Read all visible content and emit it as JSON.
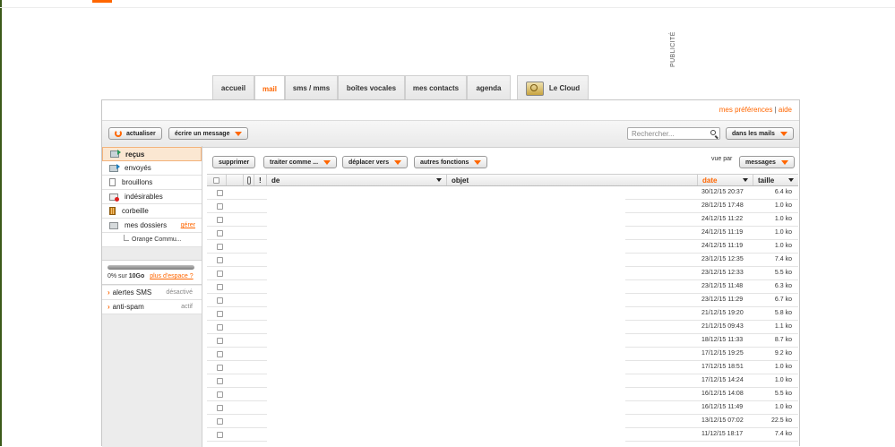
{
  "ad_label": "PUBLICITÉ",
  "tabs": [
    {
      "label": "accueil"
    },
    {
      "label": "mail"
    },
    {
      "label": "sms / mms"
    },
    {
      "label": "boîtes vocales"
    },
    {
      "label": "mes contacts"
    },
    {
      "label": "agenda"
    },
    {
      "label": "Le Cloud"
    }
  ],
  "active_tab": "mail",
  "top_links": {
    "preferences": "mes préférences",
    "separator": "|",
    "help": "aide"
  },
  "toolbar": {
    "refresh": "actualiser",
    "compose": "écrire un message",
    "search_placeholder": "Rechercher...",
    "search_scope": "dans les mails"
  },
  "folders": [
    {
      "label": "reçus"
    },
    {
      "label": "envoyés"
    },
    {
      "label": "brouillons"
    },
    {
      "label": "indésirables"
    },
    {
      "label": "corbeille"
    },
    {
      "label": "mes dossiers",
      "action": "gérer"
    }
  ],
  "subfolder": "Orange Commu...",
  "quota": {
    "used_text": "0% sur ",
    "total": "10Go",
    "more_link": "plus d'espace ?",
    "used_fraction": 0.0
  },
  "options": [
    {
      "label": "alertes SMS",
      "status": "désactivé"
    },
    {
      "label": "anti-spam",
      "status": "actif"
    }
  ],
  "list_toolbar": {
    "delete": "supprimer",
    "treat_as": "traiter comme ...",
    "move_to": "déplacer vers",
    "other": "autres fonctions",
    "view_by_label": "vue par",
    "view_by_value": "messages"
  },
  "columns": {
    "from": "de",
    "subject": "objet",
    "date": "date",
    "size": "taille"
  },
  "accent_color": "#ff6600",
  "messages": [
    {
      "date": "30/12/15 20:37",
      "size": "6.4 ko"
    },
    {
      "date": "28/12/15 17:48",
      "size": "1.0 ko"
    },
    {
      "date": "24/12/15 11:22",
      "size": "1.0 ko"
    },
    {
      "date": "24/12/15 11:19",
      "size": "1.0 ko"
    },
    {
      "date": "24/12/15 11:19",
      "size": "1.0 ko"
    },
    {
      "date": "23/12/15 12:35",
      "size": "7.4 ko"
    },
    {
      "date": "23/12/15 12:33",
      "size": "5.5 ko"
    },
    {
      "date": "23/12/15 11:48",
      "size": "6.3 ko"
    },
    {
      "date": "23/12/15 11:29",
      "size": "6.7 ko"
    },
    {
      "date": "21/12/15 19:20",
      "size": "5.8 ko"
    },
    {
      "date": "21/12/15 09:43",
      "size": "1.1 ko"
    },
    {
      "date": "18/12/15 11:33",
      "size": "8.7 ko"
    },
    {
      "date": "17/12/15 19:25",
      "size": "9.2 ko"
    },
    {
      "date": "17/12/15 18:51",
      "size": "1.0 ko"
    },
    {
      "date": "17/12/15 14:24",
      "size": "1.0 ko"
    },
    {
      "date": "16/12/15 14:08",
      "size": "5.5 ko"
    },
    {
      "date": "16/12/15 11:49",
      "size": "1.0 ko"
    },
    {
      "date": "13/12/15 07:02",
      "size": "22.5 ko"
    },
    {
      "date": "11/12/15 18:17",
      "size": "7.4 ko"
    }
  ]
}
